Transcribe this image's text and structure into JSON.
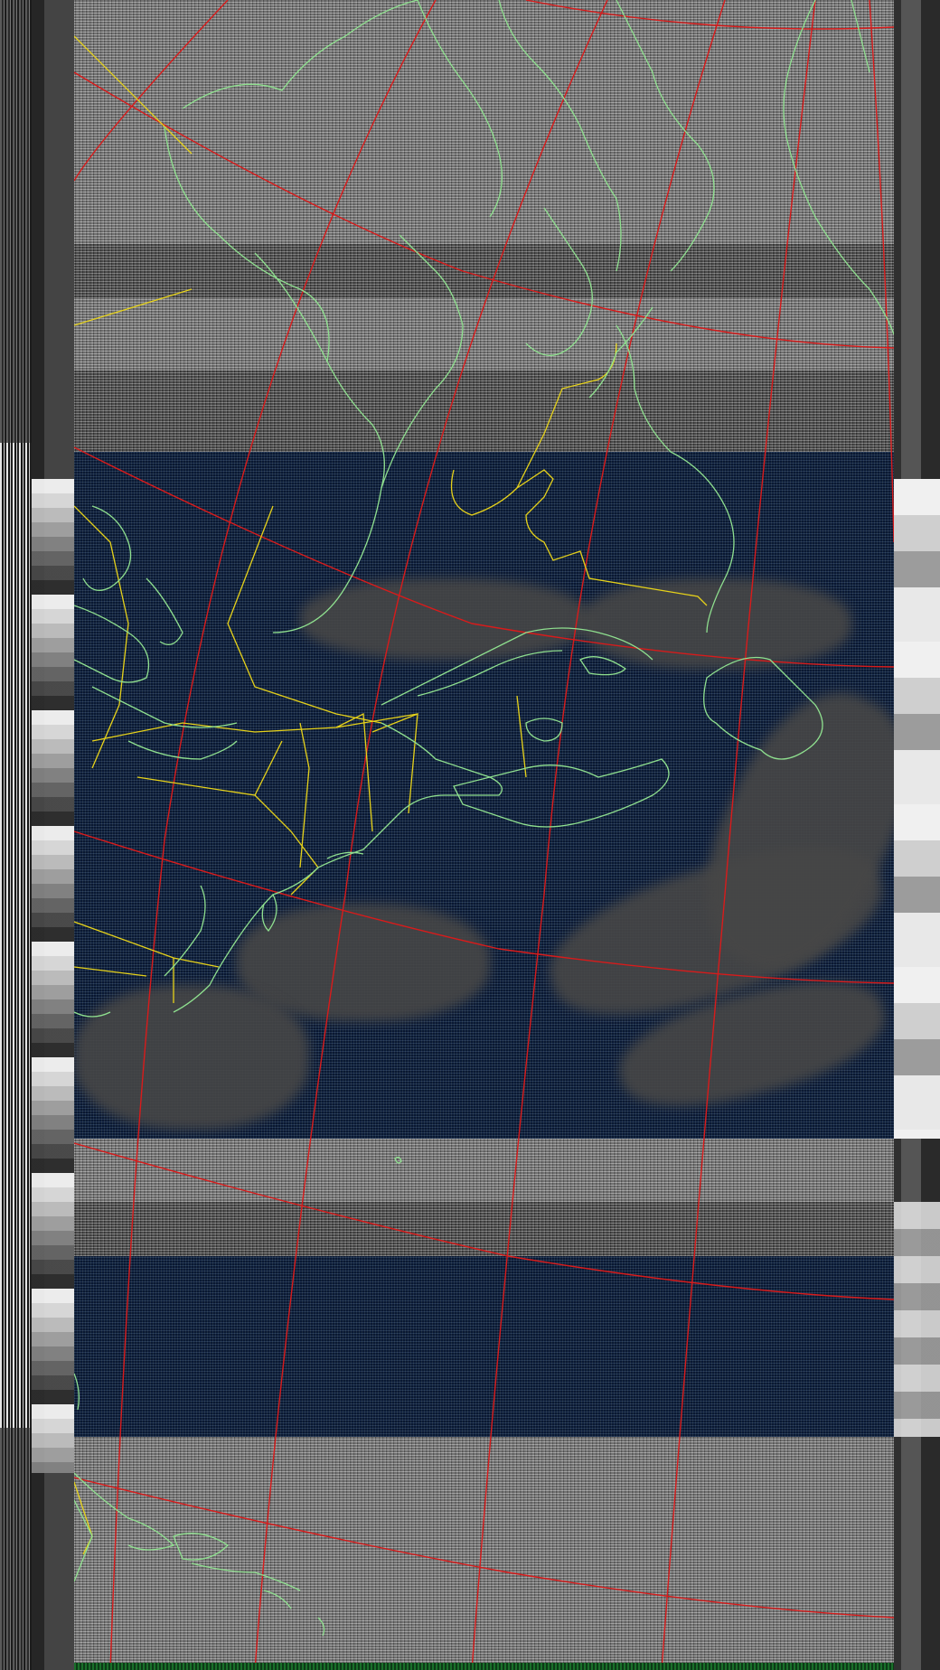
{
  "image": {
    "kind": "NOAA APT weather satellite image with map overlay",
    "colors": {
      "graticule": "#d81b1b",
      "borders": "#e6d21a",
      "coastlines": "#8fe08f",
      "ocean": "#0f2447",
      "cloud": "#464646"
    }
  },
  "layers": {
    "graticule_label": "",
    "coastline_label": "",
    "border_label": ""
  }
}
